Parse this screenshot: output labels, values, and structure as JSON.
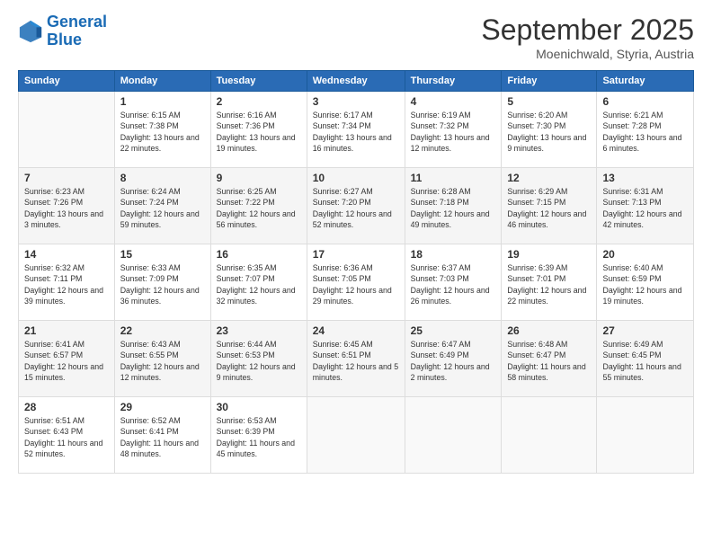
{
  "logo": {
    "line1": "General",
    "line2": "Blue"
  },
  "title": "September 2025",
  "subtitle": "Moenichwald, Styria, Austria",
  "days_of_week": [
    "Sunday",
    "Monday",
    "Tuesday",
    "Wednesday",
    "Thursday",
    "Friday",
    "Saturday"
  ],
  "weeks": [
    [
      {
        "day": "",
        "sunrise": "",
        "sunset": "",
        "daylight": ""
      },
      {
        "day": "1",
        "sunrise": "Sunrise: 6:15 AM",
        "sunset": "Sunset: 7:38 PM",
        "daylight": "Daylight: 13 hours and 22 minutes."
      },
      {
        "day": "2",
        "sunrise": "Sunrise: 6:16 AM",
        "sunset": "Sunset: 7:36 PM",
        "daylight": "Daylight: 13 hours and 19 minutes."
      },
      {
        "day": "3",
        "sunrise": "Sunrise: 6:17 AM",
        "sunset": "Sunset: 7:34 PM",
        "daylight": "Daylight: 13 hours and 16 minutes."
      },
      {
        "day": "4",
        "sunrise": "Sunrise: 6:19 AM",
        "sunset": "Sunset: 7:32 PM",
        "daylight": "Daylight: 13 hours and 12 minutes."
      },
      {
        "day": "5",
        "sunrise": "Sunrise: 6:20 AM",
        "sunset": "Sunset: 7:30 PM",
        "daylight": "Daylight: 13 hours and 9 minutes."
      },
      {
        "day": "6",
        "sunrise": "Sunrise: 6:21 AM",
        "sunset": "Sunset: 7:28 PM",
        "daylight": "Daylight: 13 hours and 6 minutes."
      }
    ],
    [
      {
        "day": "7",
        "sunrise": "Sunrise: 6:23 AM",
        "sunset": "Sunset: 7:26 PM",
        "daylight": "Daylight: 13 hours and 3 minutes."
      },
      {
        "day": "8",
        "sunrise": "Sunrise: 6:24 AM",
        "sunset": "Sunset: 7:24 PM",
        "daylight": "Daylight: 12 hours and 59 minutes."
      },
      {
        "day": "9",
        "sunrise": "Sunrise: 6:25 AM",
        "sunset": "Sunset: 7:22 PM",
        "daylight": "Daylight: 12 hours and 56 minutes."
      },
      {
        "day": "10",
        "sunrise": "Sunrise: 6:27 AM",
        "sunset": "Sunset: 7:20 PM",
        "daylight": "Daylight: 12 hours and 52 minutes."
      },
      {
        "day": "11",
        "sunrise": "Sunrise: 6:28 AM",
        "sunset": "Sunset: 7:18 PM",
        "daylight": "Daylight: 12 hours and 49 minutes."
      },
      {
        "day": "12",
        "sunrise": "Sunrise: 6:29 AM",
        "sunset": "Sunset: 7:15 PM",
        "daylight": "Daylight: 12 hours and 46 minutes."
      },
      {
        "day": "13",
        "sunrise": "Sunrise: 6:31 AM",
        "sunset": "Sunset: 7:13 PM",
        "daylight": "Daylight: 12 hours and 42 minutes."
      }
    ],
    [
      {
        "day": "14",
        "sunrise": "Sunrise: 6:32 AM",
        "sunset": "Sunset: 7:11 PM",
        "daylight": "Daylight: 12 hours and 39 minutes."
      },
      {
        "day": "15",
        "sunrise": "Sunrise: 6:33 AM",
        "sunset": "Sunset: 7:09 PM",
        "daylight": "Daylight: 12 hours and 36 minutes."
      },
      {
        "day": "16",
        "sunrise": "Sunrise: 6:35 AM",
        "sunset": "Sunset: 7:07 PM",
        "daylight": "Daylight: 12 hours and 32 minutes."
      },
      {
        "day": "17",
        "sunrise": "Sunrise: 6:36 AM",
        "sunset": "Sunset: 7:05 PM",
        "daylight": "Daylight: 12 hours and 29 minutes."
      },
      {
        "day": "18",
        "sunrise": "Sunrise: 6:37 AM",
        "sunset": "Sunset: 7:03 PM",
        "daylight": "Daylight: 12 hours and 26 minutes."
      },
      {
        "day": "19",
        "sunrise": "Sunrise: 6:39 AM",
        "sunset": "Sunset: 7:01 PM",
        "daylight": "Daylight: 12 hours and 22 minutes."
      },
      {
        "day": "20",
        "sunrise": "Sunrise: 6:40 AM",
        "sunset": "Sunset: 6:59 PM",
        "daylight": "Daylight: 12 hours and 19 minutes."
      }
    ],
    [
      {
        "day": "21",
        "sunrise": "Sunrise: 6:41 AM",
        "sunset": "Sunset: 6:57 PM",
        "daylight": "Daylight: 12 hours and 15 minutes."
      },
      {
        "day": "22",
        "sunrise": "Sunrise: 6:43 AM",
        "sunset": "Sunset: 6:55 PM",
        "daylight": "Daylight: 12 hours and 12 minutes."
      },
      {
        "day": "23",
        "sunrise": "Sunrise: 6:44 AM",
        "sunset": "Sunset: 6:53 PM",
        "daylight": "Daylight: 12 hours and 9 minutes."
      },
      {
        "day": "24",
        "sunrise": "Sunrise: 6:45 AM",
        "sunset": "Sunset: 6:51 PM",
        "daylight": "Daylight: 12 hours and 5 minutes."
      },
      {
        "day": "25",
        "sunrise": "Sunrise: 6:47 AM",
        "sunset": "Sunset: 6:49 PM",
        "daylight": "Daylight: 12 hours and 2 minutes."
      },
      {
        "day": "26",
        "sunrise": "Sunrise: 6:48 AM",
        "sunset": "Sunset: 6:47 PM",
        "daylight": "Daylight: 11 hours and 58 minutes."
      },
      {
        "day": "27",
        "sunrise": "Sunrise: 6:49 AM",
        "sunset": "Sunset: 6:45 PM",
        "daylight": "Daylight: 11 hours and 55 minutes."
      }
    ],
    [
      {
        "day": "28",
        "sunrise": "Sunrise: 6:51 AM",
        "sunset": "Sunset: 6:43 PM",
        "daylight": "Daylight: 11 hours and 52 minutes."
      },
      {
        "day": "29",
        "sunrise": "Sunrise: 6:52 AM",
        "sunset": "Sunset: 6:41 PM",
        "daylight": "Daylight: 11 hours and 48 minutes."
      },
      {
        "day": "30",
        "sunrise": "Sunrise: 6:53 AM",
        "sunset": "Sunset: 6:39 PM",
        "daylight": "Daylight: 11 hours and 45 minutes."
      },
      {
        "day": "",
        "sunrise": "",
        "sunset": "",
        "daylight": ""
      },
      {
        "day": "",
        "sunrise": "",
        "sunset": "",
        "daylight": ""
      },
      {
        "day": "",
        "sunrise": "",
        "sunset": "",
        "daylight": ""
      },
      {
        "day": "",
        "sunrise": "",
        "sunset": "",
        "daylight": ""
      }
    ]
  ]
}
